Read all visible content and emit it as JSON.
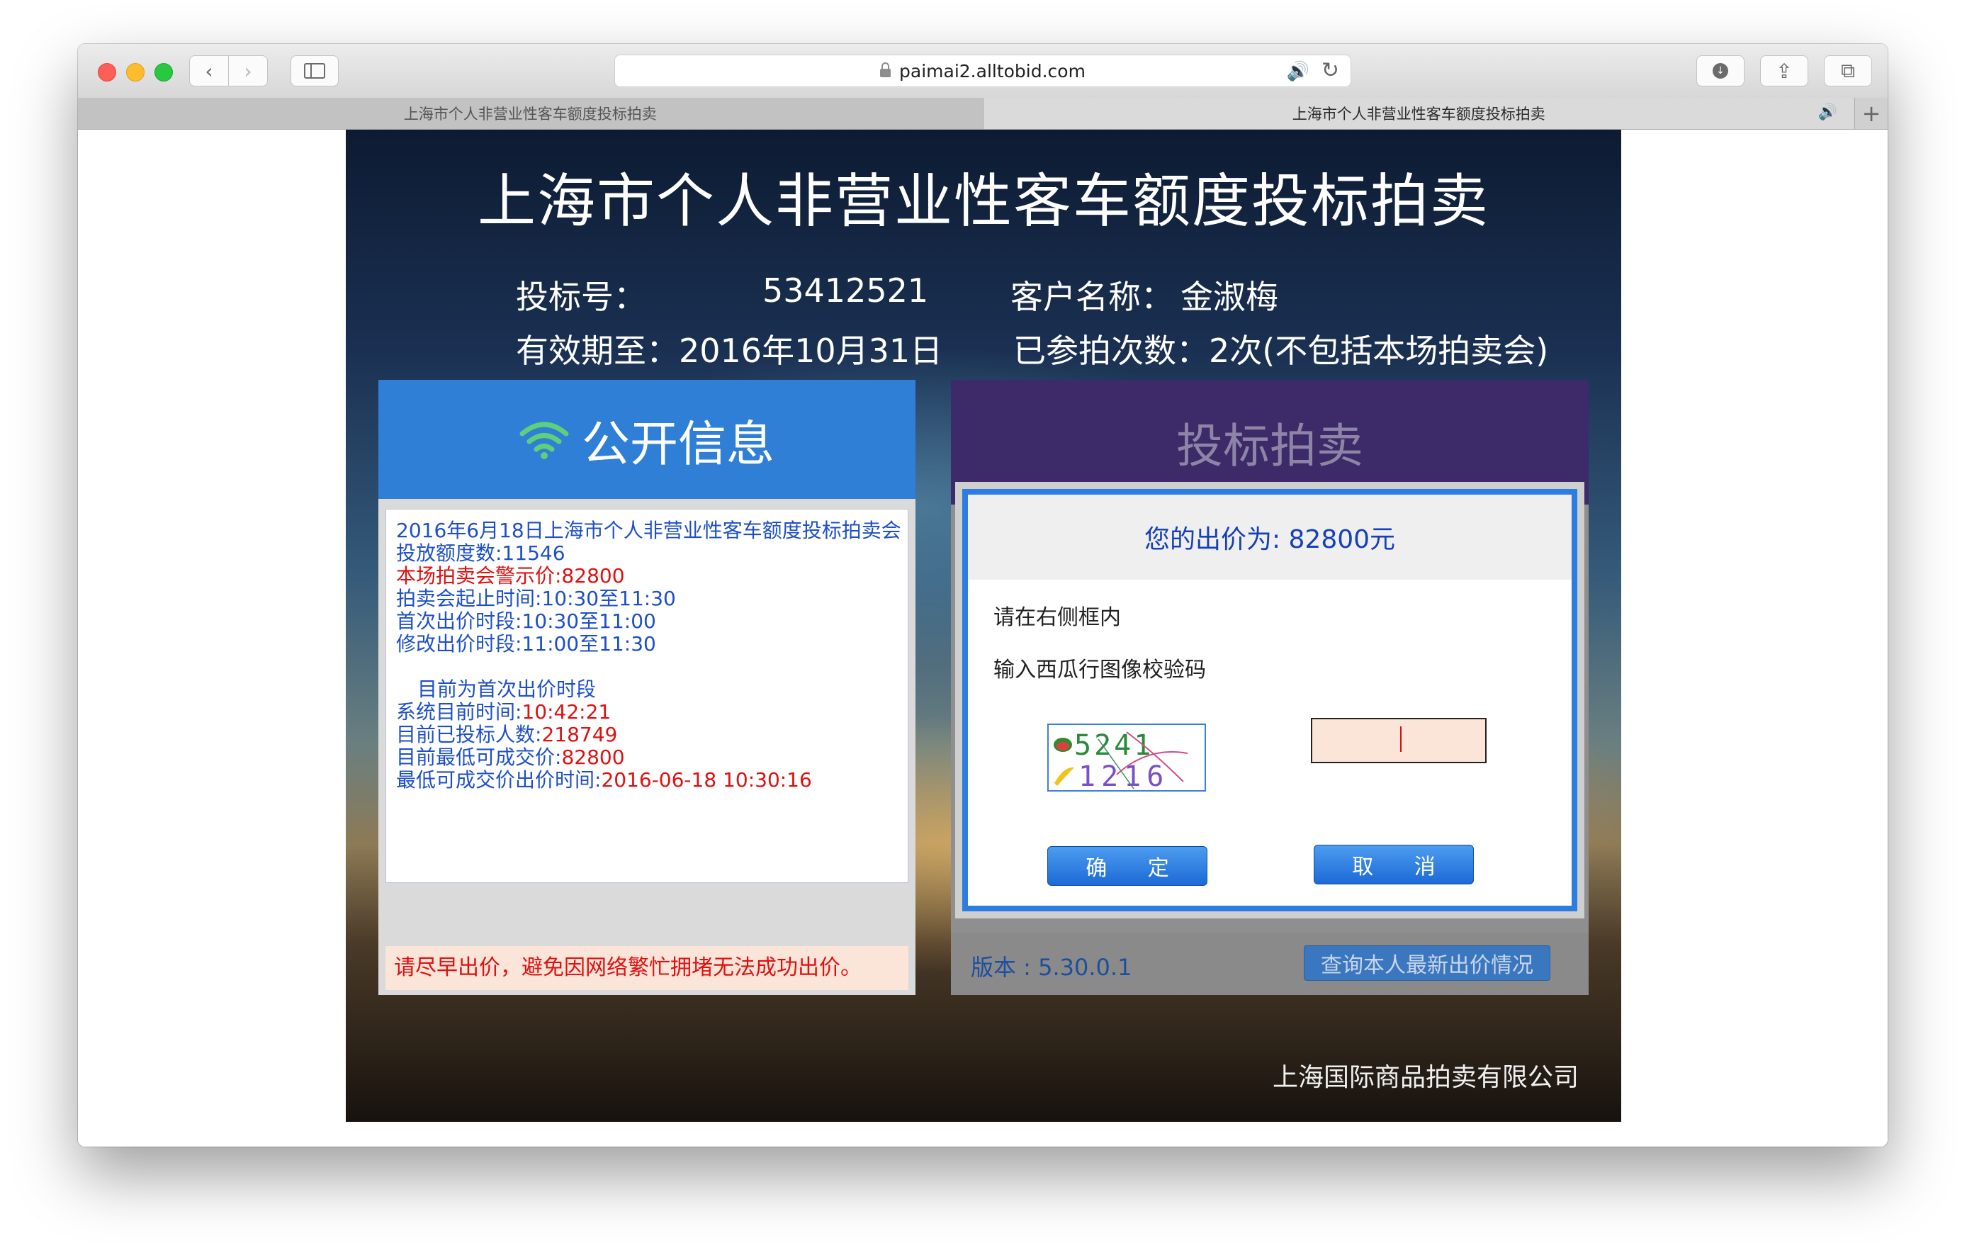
{
  "browser": {
    "url": "paimai2.alltobid.com",
    "tabs": [
      {
        "label": "上海市个人非营业性客车额度投标拍卖",
        "active": false
      },
      {
        "label": "上海市个人非营业性客车额度投标拍卖",
        "active": true
      }
    ],
    "icons": {
      "back": "‹",
      "forward": "›",
      "speaker": "🔊",
      "reload": "↻",
      "download": "↓",
      "share": "⇪",
      "tabs_overview": "⧉",
      "new_tab": "+"
    }
  },
  "page": {
    "title": "上海市个人非营业性客车额度投标拍卖",
    "bid_number_label": "投标号：",
    "bid_number": "53412521",
    "customer_label": "客户名称：",
    "customer_name": "金淑梅",
    "valid_until": "有效期至：2016年10月31日",
    "participation": "已参拍次数：2次(不包括本场拍卖会)",
    "company": "上海国际商品拍卖有限公司"
  },
  "public_info": {
    "header": "公开信息",
    "lines": [
      {
        "text": "2016年6月18日上海市个人非营业性客车额度投标拍卖会",
        "color": "blue"
      },
      {
        "text": "投放额度数:11546",
        "color": "blue"
      },
      {
        "text": "本场拍卖会警示价:82800",
        "color": "red"
      },
      {
        "text": "拍卖会起止时间:10:30至11:30",
        "color": "blue"
      },
      {
        "text": "首次出价时段:10:30至11:00",
        "color": "blue"
      },
      {
        "text": "修改出价时段:11:00至11:30",
        "color": "blue"
      }
    ],
    "phase": "目前为首次出价时段",
    "system_time_label": "系统目前时间:",
    "system_time": "10:42:21",
    "bidders_label": "目前已投标人数:",
    "bidders": "218749",
    "lowest_price_label": "目前最低可成交价:",
    "lowest_price": "82800",
    "lowest_time_label": "最低可成交价出价时间:",
    "lowest_time": "2016-06-18 10:30:16",
    "warning": "请尽早出价，避免因网络繁忙拥堵无法成功出价。"
  },
  "bidding": {
    "header": "投标拍卖",
    "price_label": "您的出价为: 82800元",
    "prompt_line1": "请在右侧框内",
    "prompt_line2": "输入西瓜行图像校验码",
    "captcha_row1": "5241",
    "captcha_row2": "1216",
    "captcha_input_value": "",
    "confirm_label": "确 定",
    "cancel_label": "取 消",
    "version": "版本 : 5.30.0.1",
    "query_label": "查询本人最新出价情况"
  }
}
